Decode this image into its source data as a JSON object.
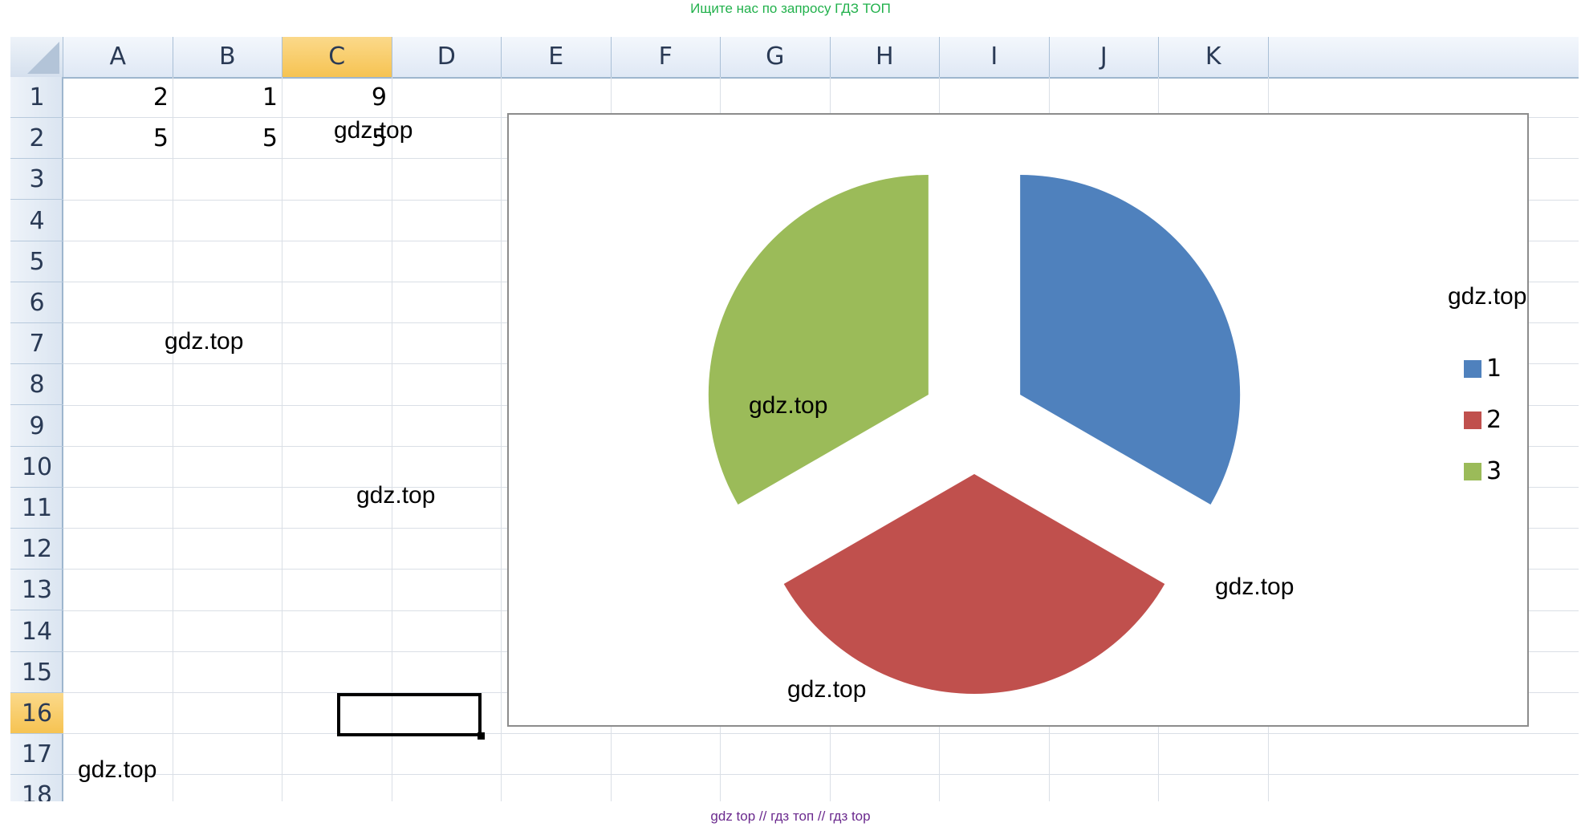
{
  "banner_top": "Ищите нас по запросу ГДЗ ТОП",
  "banner_bottom": "gdz top  //  гдз топ  //  гдз top",
  "columns": [
    "A",
    "B",
    "C",
    "D",
    "E",
    "F",
    "G",
    "H",
    "I",
    "J",
    "K"
  ],
  "selected_column": "C",
  "rows": [
    "1",
    "2",
    "3",
    "4",
    "5",
    "6",
    "7",
    "8",
    "9",
    "10",
    "11",
    "12",
    "13",
    "14",
    "15",
    "16",
    "17",
    "18"
  ],
  "selected_row": "16",
  "cells": {
    "A1": "2",
    "B1": "1",
    "C1": "9",
    "A2": "5",
    "B2": "5",
    "C2": "5"
  },
  "watermark": "gdz.top",
  "chart_data": {
    "type": "pie",
    "exploded": true,
    "categories": [
      "1",
      "2",
      "3"
    ],
    "values": [
      1,
      1,
      1
    ],
    "colors": [
      "#4f81bd",
      "#c0504d",
      "#9bbb59"
    ],
    "legend_position": "right"
  }
}
